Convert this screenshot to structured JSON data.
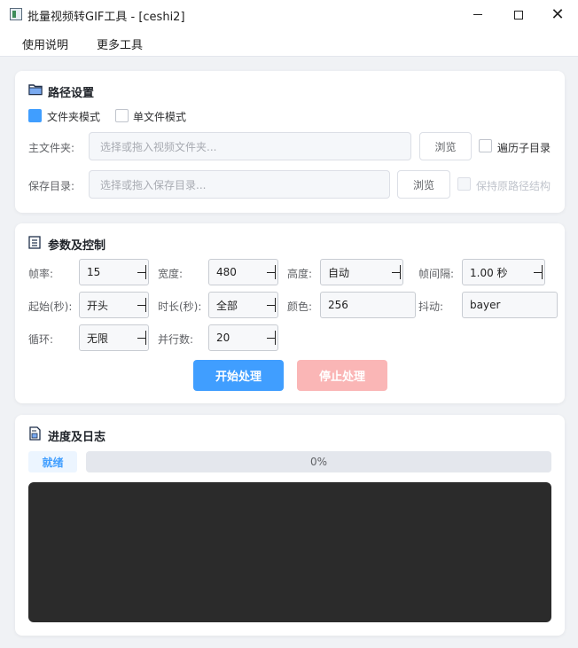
{
  "window": {
    "title": "批量视频转GIF工具 - [ceshi2]",
    "minimize_icon": "minimize-icon",
    "maximize_icon": "maximize-icon",
    "close_icon": "close-icon",
    "close_glyph": "✕"
  },
  "menu": [
    "使用说明",
    "更多工具"
  ],
  "path_section": {
    "title": "路径设置",
    "icon": "folder-icon",
    "mode_folder": {
      "label": "文件夹模式",
      "checked": true
    },
    "mode_single": {
      "label": "单文件模式",
      "checked": false
    },
    "main_folder_label": "主文件夹:",
    "main_folder_placeholder": "选择或拖入视频文件夹...",
    "browse_label": "浏览",
    "recursive": {
      "label": "遍历子目录",
      "checked": false
    },
    "save_dir_label": "保存目录:",
    "save_dir_placeholder": "选择或拖入保存目录...",
    "save_browse_label": "浏览",
    "keep_structure": {
      "label": "保持原路径结构",
      "checked": false,
      "disabled": true
    }
  },
  "params_section": {
    "title": "参数及控制",
    "icon": "list-icon",
    "fps": {
      "label": "帧率:",
      "value": "15"
    },
    "width": {
      "label": "宽度:",
      "value": "480"
    },
    "height": {
      "label": "高度:",
      "value": "自动"
    },
    "frame_interval": {
      "label": "帧间隔:",
      "value": "1.00 秒"
    },
    "start": {
      "label": "起始(秒):",
      "value": "开头"
    },
    "duration": {
      "label": "时长(秒):",
      "value": "全部"
    },
    "colors": {
      "label": "颜色:",
      "value": "256"
    },
    "dither": {
      "label": "抖动:",
      "value": "bayer"
    },
    "loop": {
      "label": "循环:",
      "value": "无限"
    },
    "parallel": {
      "label": "并行数:",
      "value": "20"
    },
    "start_button": "开始处理",
    "stop_button": "停止处理"
  },
  "progress_section": {
    "title": "进度及日志",
    "icon": "report-icon",
    "status": "就绪",
    "progress_percent": 0,
    "progress_text": "0%",
    "log_text": ""
  },
  "colors": {
    "accent": "#409eff",
    "stop_disabled": "#fab6b6",
    "log_bg": "#2b2b2b"
  }
}
